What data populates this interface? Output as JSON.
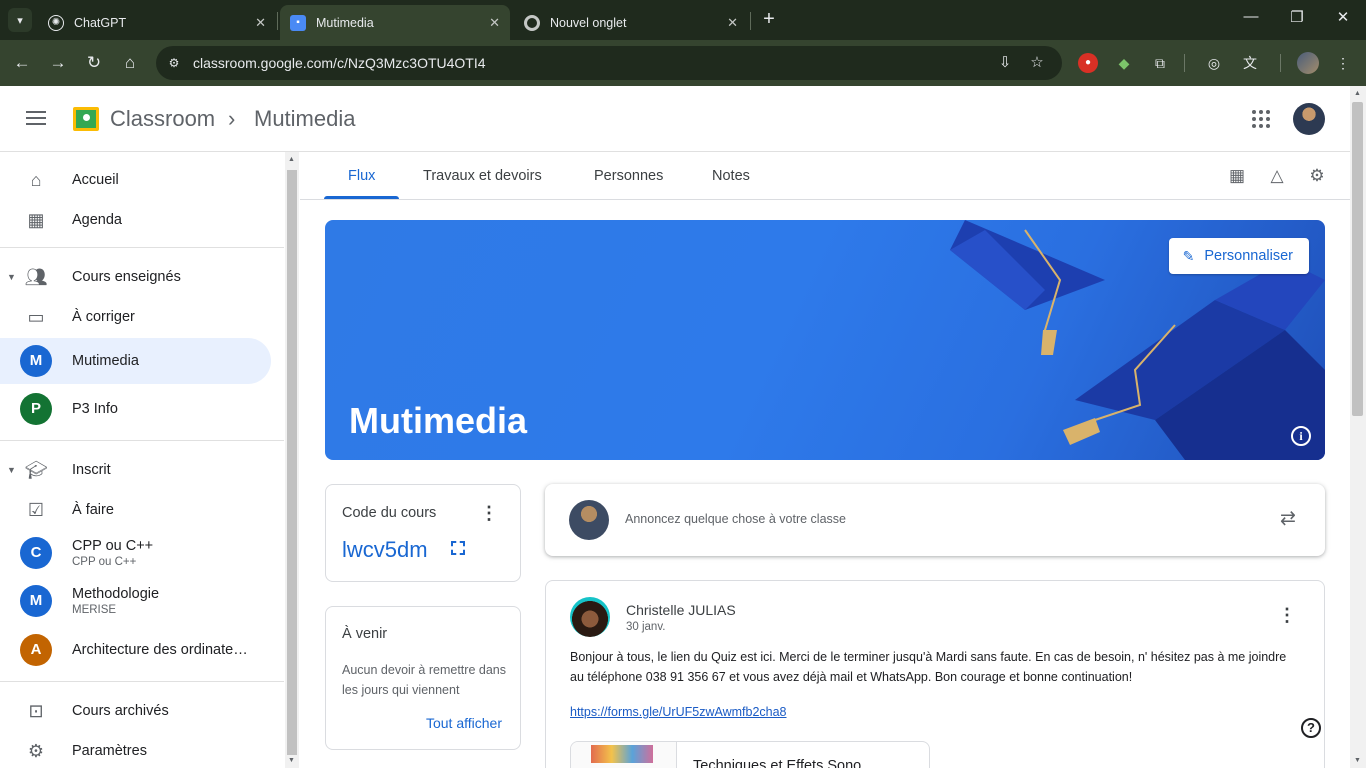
{
  "browser": {
    "tabs": [
      {
        "title": "ChatGPT",
        "icon": "chatgpt-icon"
      },
      {
        "title": "Mutimedia",
        "icon": "classroom-icon"
      },
      {
        "title": "Nouvel onglet",
        "icon": "chrome-icon"
      }
    ],
    "active_tab": 1,
    "url": "classroom.google.com/c/NzQ3Mzc3OTU4OTI4"
  },
  "header": {
    "app_name": "Classroom",
    "crumb_separator": "›",
    "course": "Mutimedia"
  },
  "sidebar": {
    "home": "Accueil",
    "calendar": "Agenda",
    "teaching_section": "Cours enseignés",
    "to_review": "À corriger",
    "teaching_courses": [
      {
        "initial": "M",
        "name": "Mutimedia",
        "color": "#1967d2"
      },
      {
        "initial": "P",
        "name": "P3 Info",
        "color": "#137333"
      }
    ],
    "enrolled_section": "Inscrit",
    "to_do": "À faire",
    "enrolled_courses": [
      {
        "initial": "C",
        "name": "CPP ou C++",
        "sub": "CPP ou C++",
        "color": "#1967d2"
      },
      {
        "initial": "M",
        "name": "Methodologie",
        "sub": "MERISE",
        "color": "#1967d2"
      },
      {
        "initial": "A",
        "name": "Architecture des ordinate…",
        "sub": "",
        "color": "#c26401"
      }
    ],
    "archived": "Cours archivés",
    "settings": "Paramètres"
  },
  "tabs": {
    "items": [
      "Flux",
      "Travaux et devoirs",
      "Personnes",
      "Notes"
    ],
    "active": 0
  },
  "banner": {
    "title": "Mutimedia",
    "customize": "Personnaliser"
  },
  "code_card": {
    "title": "Code du cours",
    "code": "lwcv5dm"
  },
  "upcoming": {
    "title": "À venir",
    "empty": "Aucun devoir à remettre dans les jours qui viennent",
    "view_all": "Tout afficher"
  },
  "announce": {
    "placeholder": "Annoncez quelque chose à votre classe"
  },
  "post": {
    "author": "Christelle JULIAS",
    "date": "30 janv.",
    "body": "Bonjour à tous, le lien du Quiz est ici. Merci de le terminer jusqu'à Mardi sans faute.  En cas de besoin, n' hésitez pas à me joindre au téléphone 038 91 356 67 et vous avez déjà mail et WhatsApp. Bon courage et bonne continuation!",
    "link": "https://forms.gle/UrUF5zwAwmfb2cha8",
    "attachment_title": "Techniques et Effets Sono"
  },
  "colors": {
    "accent": "#1967d2",
    "browser_dark": "#1f2a1d",
    "browser_toolbar": "#35442f",
    "banner": "#2f7ae6"
  }
}
